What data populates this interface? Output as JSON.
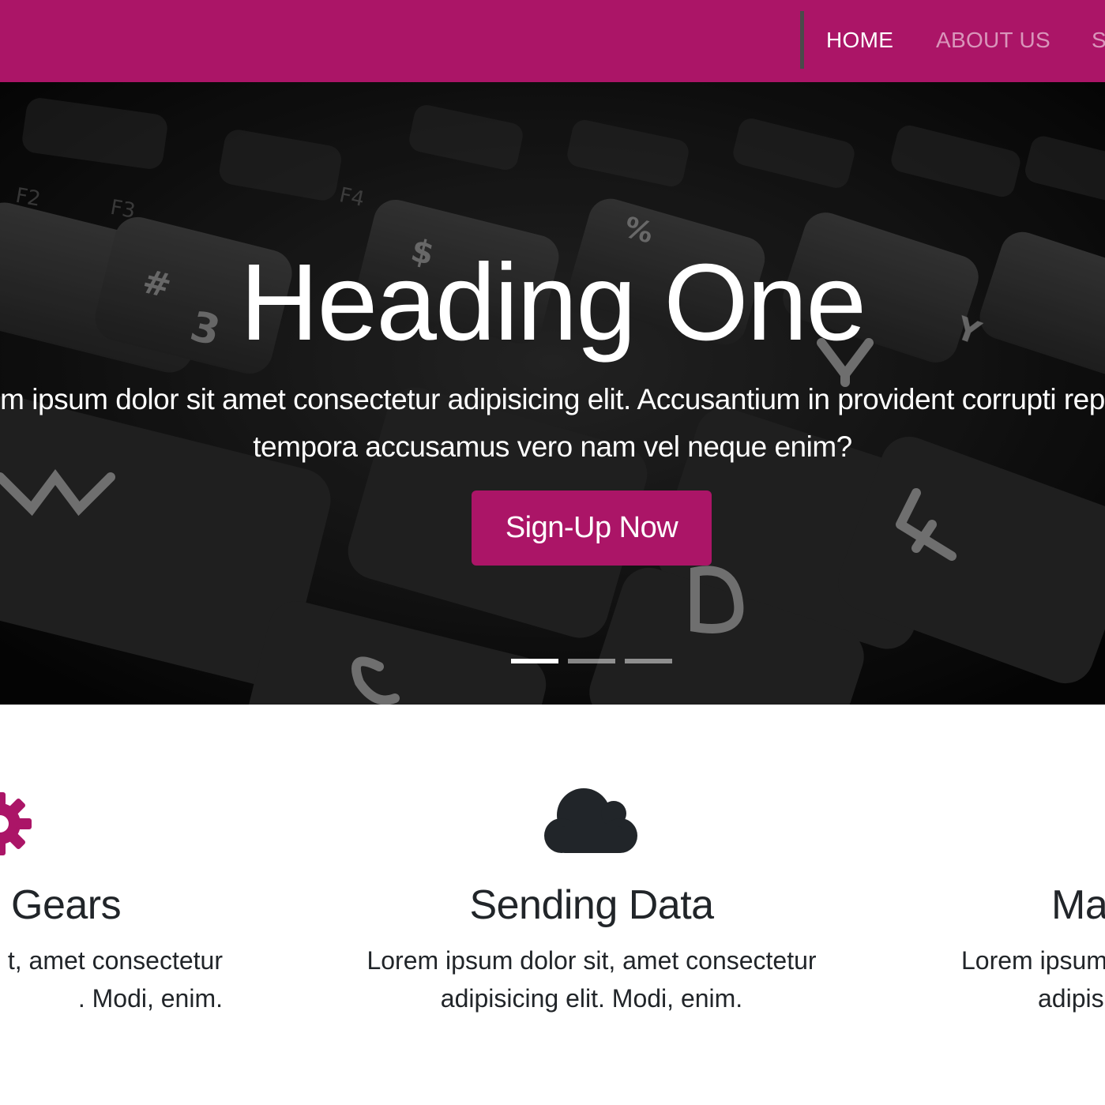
{
  "navbar": {
    "bg_color": "#ab1567",
    "links": [
      {
        "label": "HOME",
        "active": true
      },
      {
        "label": "ABOUT US",
        "active": false
      },
      {
        "label": "S",
        "active": false
      }
    ]
  },
  "hero": {
    "heading": "Heading One",
    "text_line1": "m ipsum dolor sit amet consectetur adipisicing elit. Accusantium in provident corrupti rep",
    "text_line2": "tempora accusamus vero nam vel neque enim?",
    "button_label": "Sign-Up Now",
    "indicators": {
      "count": 3,
      "active_index": 0
    }
  },
  "features": [
    {
      "icon": "gear-icon",
      "icon_color": "#ab1567",
      "title": "Gears",
      "text_line1": "t, amet consectetur",
      "text_line2": ". Modi, enim."
    },
    {
      "icon": "cloud-icon",
      "icon_color": "#212529",
      "title": "Sending Data",
      "text_line1": "Lorem ipsum dolor sit, amet consectetur",
      "text_line2": "adipisicing elit. Modi, enim."
    },
    {
      "icon": "unknown-icon",
      "icon_color": "#212529",
      "title": "Ma",
      "text_line1": "Lorem ipsum",
      "text_line2": "adipis"
    }
  ],
  "colors": {
    "accent": "#ab1567",
    "text_dark": "#212529",
    "hero_bg": "#0b0b0b"
  }
}
